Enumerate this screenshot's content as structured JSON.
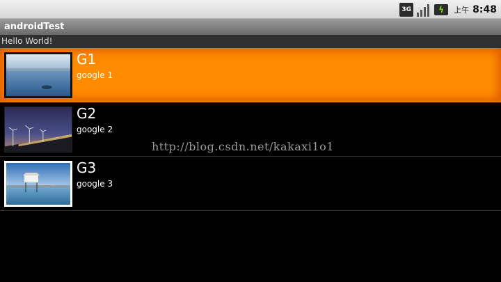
{
  "status_bar": {
    "network_badge": "3G",
    "signal_icon": "signal-bars-icon",
    "battery_icon": "battery-charging-icon",
    "ampm": "上午",
    "time": "8:48"
  },
  "app": {
    "title": "androidTest",
    "hello_text": "Hello World!"
  },
  "list": {
    "items": [
      {
        "title": "G1",
        "subtitle": "google 1",
        "image": "seascape-photo"
      },
      {
        "title": "G2",
        "subtitle": "google 2",
        "image": "wind-turbines-photo"
      },
      {
        "title": "G3",
        "subtitle": "google 3",
        "image": "pier-house-photo"
      }
    ],
    "selected_index": 0
  },
  "watermark": "http://blog.csdn.net/kakaxi1o1",
  "colors": {
    "selection": "#ff8c00",
    "background": "#000000",
    "titlebar": "#7a7a7a"
  }
}
